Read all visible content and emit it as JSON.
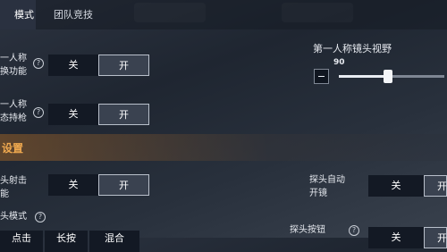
{
  "tabs": {
    "active": "模式",
    "other": "团队竞技"
  },
  "fp_toggle": {
    "label": "一人称\n换功能",
    "off": "关",
    "on": "开"
  },
  "fp_hold": {
    "label": "一人称\n态持枪",
    "off": "关",
    "on": "开"
  },
  "fov": {
    "title": "第一人称镜头视野",
    "value": "90",
    "fraction": 0.47
  },
  "section": {
    "title": "设置"
  },
  "peek_fire": {
    "label": "头射击\n能",
    "off": "关",
    "on": "开"
  },
  "peek_auto": {
    "label": "探头自动\n开镜",
    "off": "关",
    "on": "开"
  },
  "peek_mode": {
    "label": "头模式",
    "options": [
      "点击",
      "长按",
      "混合"
    ]
  },
  "peek_button": {
    "label": "探头按钮",
    "off": "关",
    "on": "开"
  }
}
